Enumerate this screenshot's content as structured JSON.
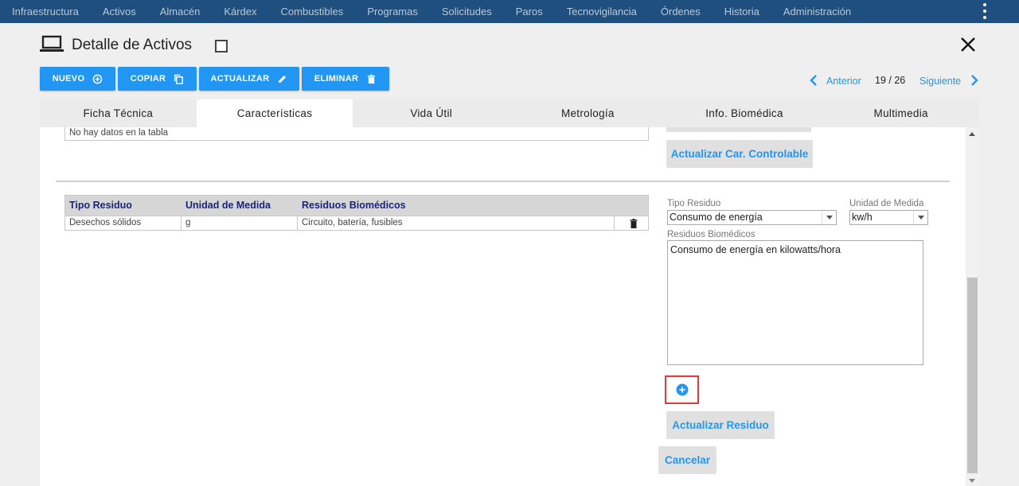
{
  "nav": {
    "items": [
      "Infraestructura",
      "Activos",
      "Almacén",
      "Kárdex",
      "Combustibles",
      "Programas",
      "Solicitudes",
      "Paros",
      "Tecnovigilancia",
      "Órdenes",
      "Historia",
      "Administración"
    ]
  },
  "header": {
    "title": "Detalle de Activos"
  },
  "toolbar": {
    "nuevo": "NUEVO",
    "copiar": "COPIAR",
    "actualizar": "ACTUALIZAR",
    "eliminar": "ELIMINAR"
  },
  "pager": {
    "prev": "Anterior",
    "count": "19 / 26",
    "next": "Siguiente"
  },
  "tabs": [
    "Ficha Técnica",
    "Características",
    "Vida Útil",
    "Metrología",
    "Info. Biomédica",
    "Multimedia"
  ],
  "controllable": {
    "empty_message": "No hay datos en la tabla",
    "update_button": "Actualizar Car. Controlable"
  },
  "residue_table": {
    "headers": [
      "Tipo Residuo",
      "Unidad de Medida",
      "Residuos Biomédicos"
    ],
    "rows": [
      [
        "Desechos sólidos",
        "g",
        "Circuito, batería, fusibles"
      ]
    ]
  },
  "form": {
    "tipo_label": "Tipo Residuo",
    "tipo_value": "Consumo de energía",
    "unidad_label": "Unidad de Medida",
    "unidad_value": "kw/h",
    "residuos_label": "Residuos Biomédicos",
    "residuos_value": "Consumo de energía en kilowatts/hora",
    "update_button": "Actualizar Residuo",
    "cancel_button": "Cancelar"
  },
  "colors": {
    "nav_bg": "#1f4f7e",
    "accent": "#2196f3",
    "header_text": "#1a237e",
    "highlight": "#e53935"
  }
}
